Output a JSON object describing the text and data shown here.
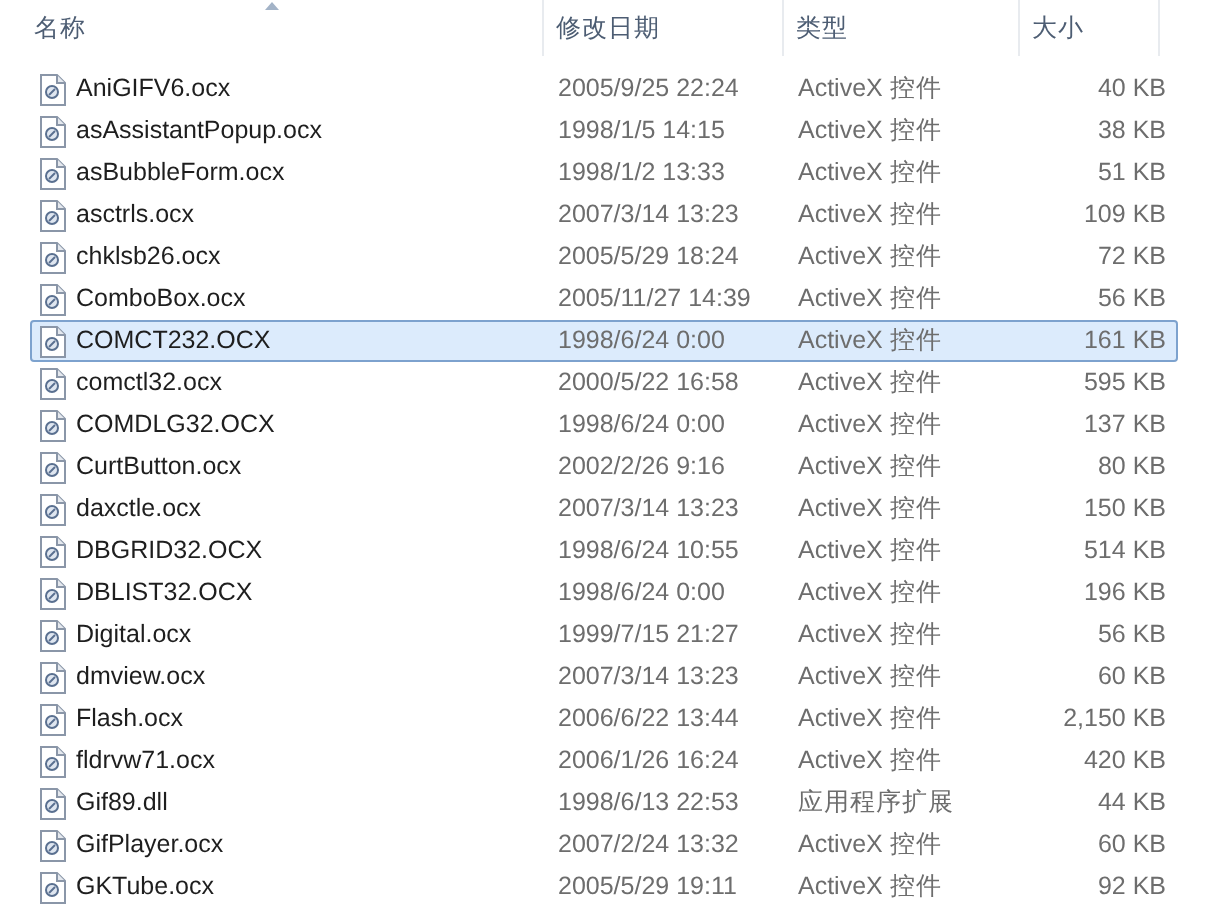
{
  "columns": [
    {
      "label": "名称",
      "sorted": true
    },
    {
      "label": "修改日期",
      "sorted": false
    },
    {
      "label": "类型",
      "sorted": false
    },
    {
      "label": "大小",
      "sorted": false
    }
  ],
  "rows": [
    {
      "name": "AniGIFV6.ocx",
      "date": "2005/9/25 22:24",
      "type": "ActiveX 控件",
      "size": "40 KB",
      "selected": false
    },
    {
      "name": "asAssistantPopup.ocx",
      "date": "1998/1/5 14:15",
      "type": "ActiveX 控件",
      "size": "38 KB",
      "selected": false
    },
    {
      "name": "asBubbleForm.ocx",
      "date": "1998/1/2 13:33",
      "type": "ActiveX 控件",
      "size": "51 KB",
      "selected": false
    },
    {
      "name": "asctrls.ocx",
      "date": "2007/3/14 13:23",
      "type": "ActiveX 控件",
      "size": "109 KB",
      "selected": false
    },
    {
      "name": "chklsb26.ocx",
      "date": "2005/5/29 18:24",
      "type": "ActiveX 控件",
      "size": "72 KB",
      "selected": false
    },
    {
      "name": "ComboBox.ocx",
      "date": "2005/11/27 14:39",
      "type": "ActiveX 控件",
      "size": "56 KB",
      "selected": false
    },
    {
      "name": "COMCT232.OCX",
      "date": "1998/6/24 0:00",
      "type": "ActiveX 控件",
      "size": "161 KB",
      "selected": true
    },
    {
      "name": "comctl32.ocx",
      "date": "2000/5/22 16:58",
      "type": "ActiveX 控件",
      "size": "595 KB",
      "selected": false
    },
    {
      "name": "COMDLG32.OCX",
      "date": "1998/6/24 0:00",
      "type": "ActiveX 控件",
      "size": "137 KB",
      "selected": false
    },
    {
      "name": "CurtButton.ocx",
      "date": "2002/2/26 9:16",
      "type": "ActiveX 控件",
      "size": "80 KB",
      "selected": false
    },
    {
      "name": "daxctle.ocx",
      "date": "2007/3/14 13:23",
      "type": "ActiveX 控件",
      "size": "150 KB",
      "selected": false
    },
    {
      "name": "DBGRID32.OCX",
      "date": "1998/6/24 10:55",
      "type": "ActiveX 控件",
      "size": "514 KB",
      "selected": false
    },
    {
      "name": "DBLIST32.OCX",
      "date": "1998/6/24 0:00",
      "type": "ActiveX 控件",
      "size": "196 KB",
      "selected": false
    },
    {
      "name": "Digital.ocx",
      "date": "1999/7/15 21:27",
      "type": "ActiveX 控件",
      "size": "56 KB",
      "selected": false
    },
    {
      "name": "dmview.ocx",
      "date": "2007/3/14 13:23",
      "type": "ActiveX 控件",
      "size": "60 KB",
      "selected": false
    },
    {
      "name": "Flash.ocx",
      "date": "2006/6/22 13:44",
      "type": "ActiveX 控件",
      "size": "2,150 KB",
      "selected": false
    },
    {
      "name": "fldrvw71.ocx",
      "date": "2006/1/26 16:24",
      "type": "ActiveX 控件",
      "size": "420 KB",
      "selected": false
    },
    {
      "name": "Gif89.dll",
      "date": "1998/6/13 22:53",
      "type": "应用程序扩展",
      "size": "44 KB",
      "selected": false
    },
    {
      "name": "GifPlayer.ocx",
      "date": "2007/2/24 13:32",
      "type": "ActiveX 控件",
      "size": "60 KB",
      "selected": false
    },
    {
      "name": "GKTube.ocx",
      "date": "2005/5/29 19:11",
      "type": "ActiveX 控件",
      "size": "92 KB",
      "selected": false
    }
  ]
}
